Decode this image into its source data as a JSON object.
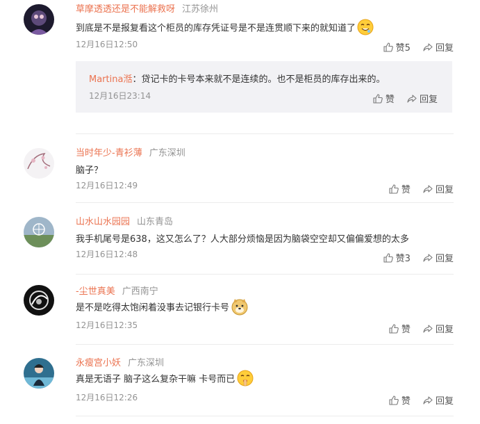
{
  "comments": [
    {
      "username": "草摩透透还是不能解救呀",
      "location": "江苏徐州",
      "text": "到底是不是报复看这个柜员的库存凭证号是不是连贯顺下来的就知道了",
      "emoji": "drooling-face-emoji",
      "time": "12月16日12:50",
      "like_label": "赞5",
      "reply_label": "回复",
      "reply": {
        "username": "Martina湉",
        "text": "：贷记卡的卡号本来就不是连续的。也不是柜员的库存出来的。",
        "time": "12月16日23:14",
        "like_label": "赞",
        "reply_label": "回复"
      }
    },
    {
      "username": "当时年少-青衫薄",
      "location": "广东深圳",
      "text": "脑子？",
      "time": "12月16日12:49",
      "like_label": "赞",
      "reply_label": "回复"
    },
    {
      "username": "山水山水园园",
      "location": "山东青岛",
      "text": "我手机尾号是638，这又怎么了？人大部分烦恼是因为脑袋空空却又偏偏爱想的太多",
      "time": "12月16日12:48",
      "like_label": "赞3",
      "reply_label": "回复"
    },
    {
      "username": "-尘世真美",
      "location": "广西南宁",
      "text": "是不是吃得太饱闲着没事去记银行卡号",
      "emoji": "doge-emoji",
      "time": "12月16日12:35",
      "like_label": "赞",
      "reply_label": "回复"
    },
    {
      "username": "永瘦宫小妖",
      "location": "广东深圳",
      "text": "真是无语子 脑子这么复杂干嘛 卡号而已",
      "emoji": "shushing-face-emoji",
      "time": "12月16日12:26",
      "like_label": "赞",
      "reply_label": "回复"
    }
  ],
  "colors": {
    "username": "#eb7350",
    "meta": "#939393",
    "reply_bg": "#f2f2f5"
  }
}
